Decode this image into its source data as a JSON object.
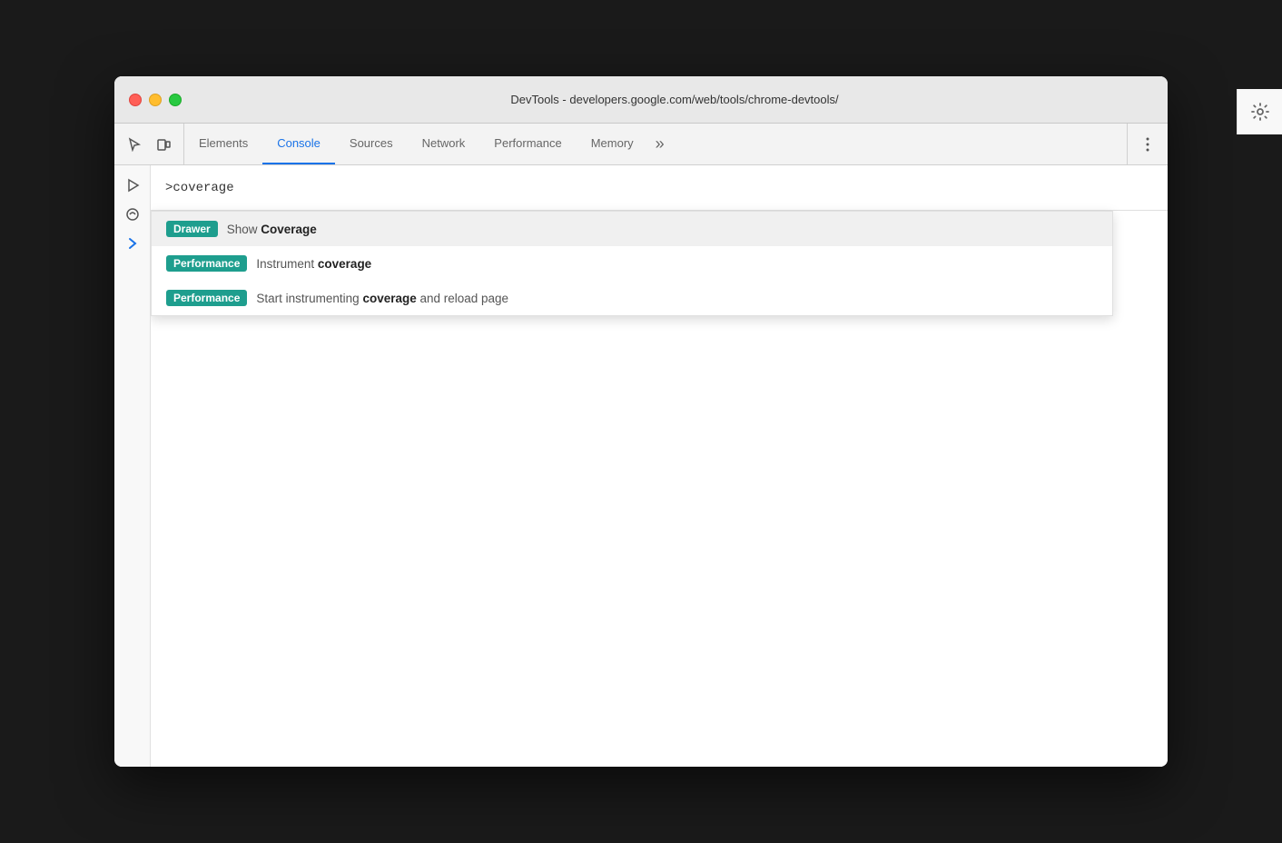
{
  "window": {
    "title": "DevTools - developers.google.com/web/tools/chrome-devtools/"
  },
  "trafficLights": {
    "close": "close",
    "minimize": "minimize",
    "maximize": "maximize"
  },
  "toolbar": {
    "tabs": [
      {
        "id": "elements",
        "label": "Elements",
        "active": false
      },
      {
        "id": "console",
        "label": "Console",
        "active": true
      },
      {
        "id": "sources",
        "label": "Sources",
        "active": false
      },
      {
        "id": "network",
        "label": "Network",
        "active": false
      },
      {
        "id": "performance",
        "label": "Performance",
        "active": false
      },
      {
        "id": "memory",
        "label": "Memory",
        "active": false
      }
    ],
    "moreLabel": "»",
    "moreMenuLabel": "⋮"
  },
  "commandBar": {
    "inputValue": ">coverage"
  },
  "suggestions": [
    {
      "id": "show-coverage",
      "badge": "Drawer",
      "badgeType": "drawer",
      "textBefore": "Show ",
      "textBold": "Coverage",
      "textAfter": "",
      "highlighted": true
    },
    {
      "id": "instrument-coverage",
      "badge": "Performance",
      "badgeType": "performance",
      "textBefore": "Instrument ",
      "textBold": "coverage",
      "textAfter": "",
      "highlighted": false
    },
    {
      "id": "start-instrumenting",
      "badge": "Performance",
      "badgeType": "performance",
      "textBefore": "Start instrumenting ",
      "textBold": "coverage",
      "textAfter": " and reload page",
      "highlighted": false
    }
  ]
}
